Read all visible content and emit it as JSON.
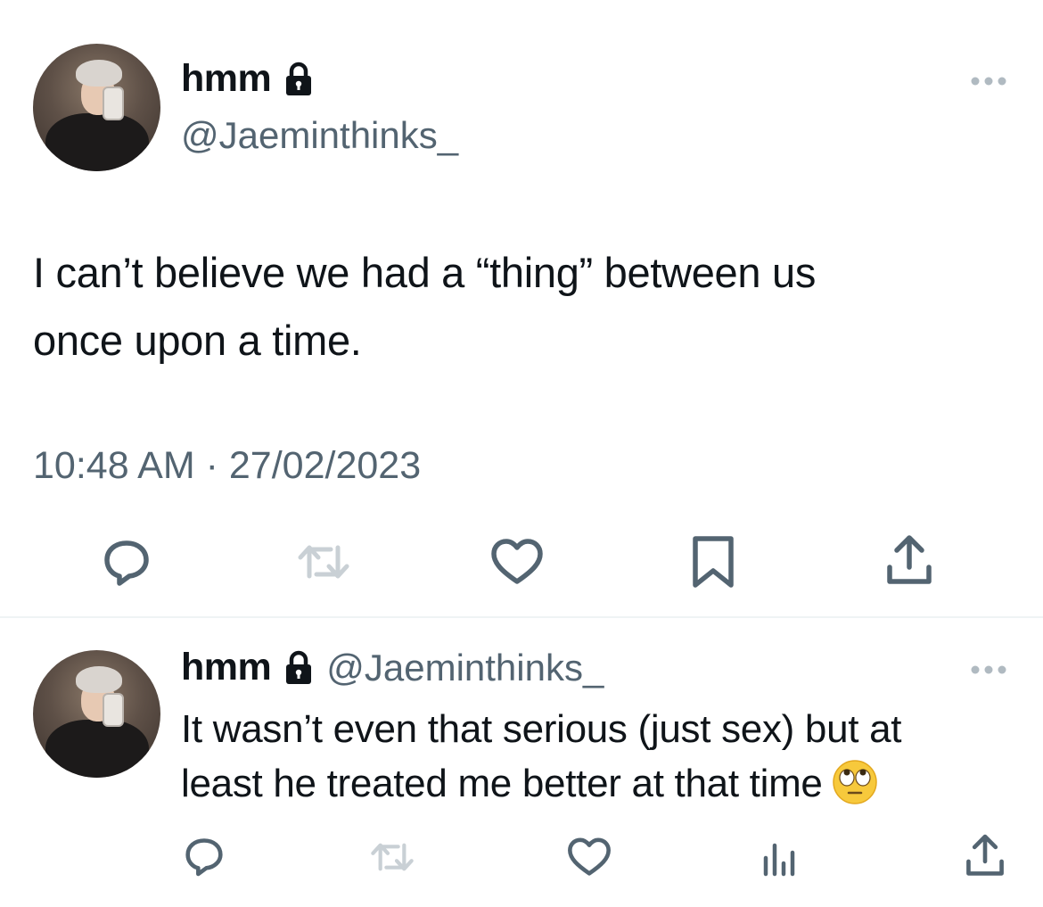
{
  "main_tweet": {
    "display_name": "hmm",
    "handle": "@Jaeminthinks_",
    "text_line1": "I can’t believe we had a “thing” between us",
    "text_line2": "once upon a time.",
    "timestamp": "10:48 AM · 27/02/2023",
    "actions": [
      "reply-icon",
      "retweet-icon",
      "like-icon",
      "bookmark-icon",
      "share-icon"
    ]
  },
  "reply_tweet": {
    "display_name": "hmm",
    "handle": "@Jaeminthinks_",
    "text_line1": "It wasn’t even that serious (just sex) but at",
    "text_line2": "least he treated me better at that time",
    "emoji": "face-with-rolling-eyes",
    "actions": [
      "reply-icon",
      "retweet-icon",
      "like-icon",
      "views-icon",
      "share-icon"
    ]
  },
  "colors": {
    "text": "#0f1419",
    "secondary": "#536471",
    "divider": "#eff3f4"
  }
}
